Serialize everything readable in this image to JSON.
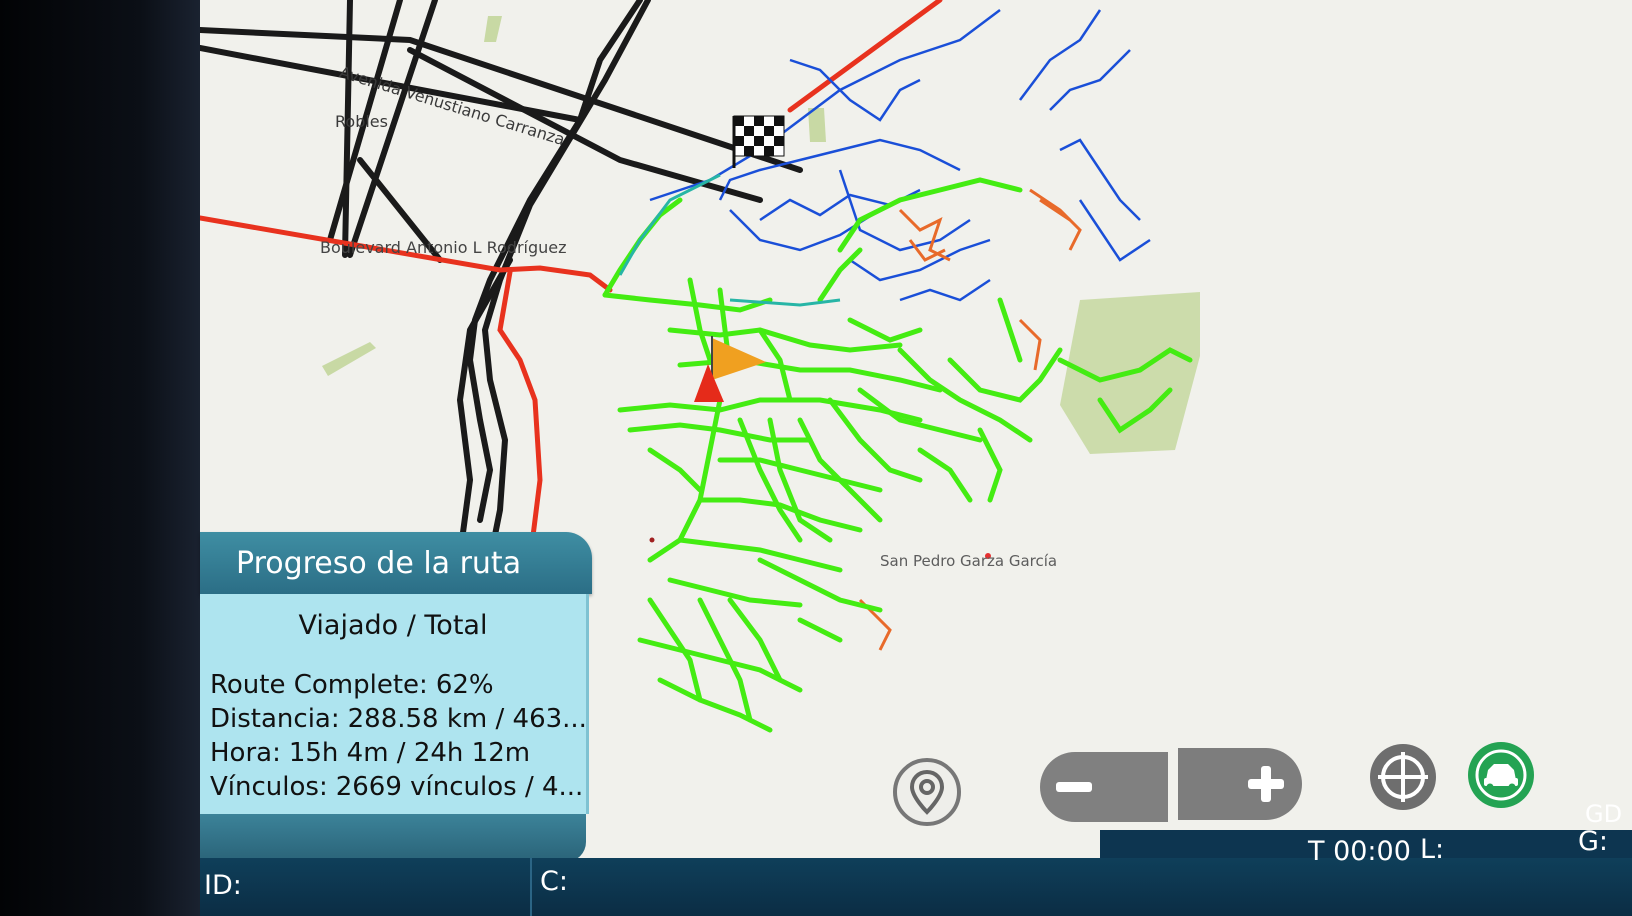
{
  "map": {
    "street_labels": {
      "venustiano": "Avenida Venustiano Carranza",
      "robles": "Robles",
      "boulevard": "Boulevard Antonio L Rodríguez",
      "san_pedro": "San Pedro Garza García"
    },
    "colors": {
      "background": "#f1f1ec",
      "road_major": "#1a1a1a",
      "road_highway": "#e8321e",
      "route_done": "#44ec12",
      "route_pending": "#1a4fd8",
      "route_alt": "#e86a2a",
      "park": "#c8d9a4"
    },
    "markers": [
      "checkered-flag-icon",
      "orange-flag-icon",
      "red-triangle-icon"
    ]
  },
  "route_progress": {
    "title": "Progreso de la ruta",
    "subtitle": "Viajado / Total",
    "route_complete_label": "Route Complete:",
    "route_complete_value": "62%",
    "distance_label": "Distancia:",
    "distance_value": "288.58 km / 463...",
    "time_label": "Hora:",
    "time_value": "15h 4m / 24h 12m",
    "links_label": "Vínculos:",
    "links_value": "2669 vínculos / 4..."
  },
  "controls": {
    "locate_icon": "map-pin-icon",
    "zoom_out_icon": "minus-icon",
    "zoom_in_icon": "plus-icon",
    "center_icon": "crosshair-icon",
    "follow_icon": "car-icon"
  },
  "status_bar": {
    "id_label": "ID:",
    "c_label": "C:",
    "t_value": "T 00:00",
    "l_label": "L:",
    "g_label": "G:",
    "gd_label": "GD"
  }
}
